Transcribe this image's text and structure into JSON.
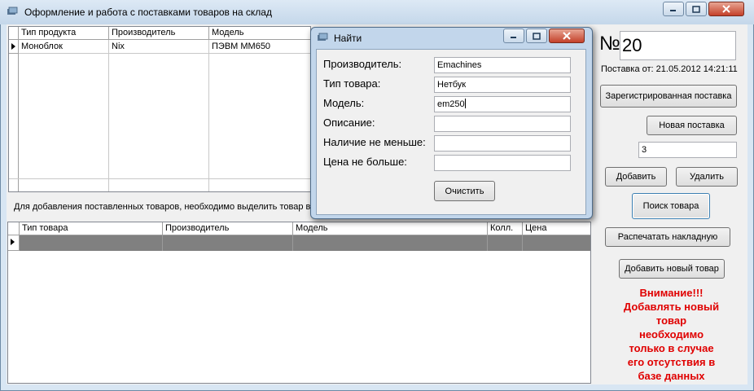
{
  "main_window": {
    "title": "Оформление и работа с поставками товаров на склад",
    "icon": "app-icon"
  },
  "products_grid": {
    "columns": [
      "Тип продукта",
      "Производитель",
      "Модель"
    ],
    "rows": [
      {
        "type": "Моноблок",
        "manufacturer": "Nix",
        "model": "ПЭВМ MM650"
      }
    ]
  },
  "hint_text": "Для добавления поставленных товаров, необходимо выделить товар в",
  "delivery_grid": {
    "columns": [
      "Тип товара",
      "Производитель",
      "Модель",
      "Колл.",
      "Цена"
    ]
  },
  "right_panel": {
    "number_sign": "№",
    "delivery_number": "20",
    "delivery_date": "Поставка от: 21.05.2012 14:21:11",
    "registered_button": "Зарегистрированная поставка",
    "new_delivery_button": "Новая поставка",
    "quantity_value": "3",
    "add_button": "Добавить",
    "delete_button": "Удалить",
    "search_button": "Поиск товара",
    "print_button": "Распечатать накладную",
    "add_new_product_button": "Добавить новый товар",
    "warning_lines": [
      "Внимание!!!",
      "Добавлять новый",
      "товар",
      "необходимо",
      "только в случае",
      "его отсутствия в",
      "базе данных"
    ],
    "warning_color": "#e00000"
  },
  "find_dialog": {
    "title": "Найти",
    "fields": [
      {
        "label": "Производитель:",
        "value": "Emachines"
      },
      {
        "label": "Тип товара:",
        "value": "Нетбук"
      },
      {
        "label": "Модель:",
        "value": "em250"
      },
      {
        "label": "Описание:",
        "value": ""
      },
      {
        "label": "Наличие не меньше:",
        "value": ""
      },
      {
        "label": "Цена не больше:",
        "value": ""
      }
    ],
    "clear_button": "Очистить"
  }
}
